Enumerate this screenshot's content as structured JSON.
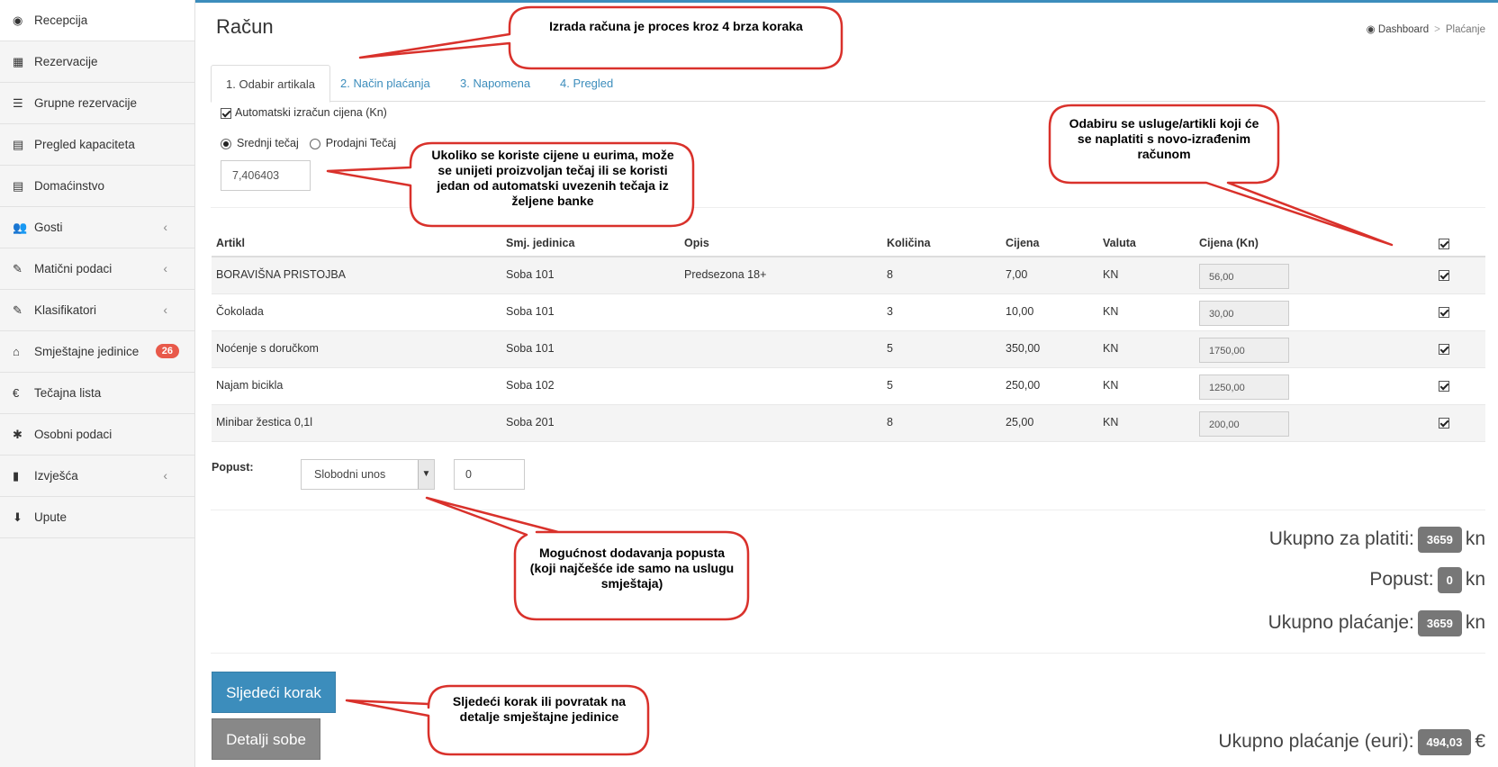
{
  "sidebar": {
    "items": [
      {
        "label": "Recepcija",
        "icon": "dashboard-icon",
        "glyph": "◉"
      },
      {
        "label": "Rezervacije",
        "icon": "grid-icon",
        "glyph": "▦"
      },
      {
        "label": "Grupne rezervacije",
        "icon": "list-icon",
        "glyph": "☰"
      },
      {
        "label": "Pregled kapaciteta",
        "icon": "calendar-icon",
        "glyph": "▤"
      },
      {
        "label": "Domaćinstvo",
        "icon": "list-alt-icon",
        "glyph": "▤"
      },
      {
        "label": "Gosti",
        "icon": "users-icon",
        "glyph": "👥"
      },
      {
        "label": "Matični podaci",
        "icon": "edit-icon",
        "glyph": "✎"
      },
      {
        "label": "Klasifikatori",
        "icon": "edit-icon",
        "glyph": "✎"
      },
      {
        "label": "Smještajne jedinice",
        "icon": "home-icon",
        "glyph": "⌂",
        "badge": "26"
      },
      {
        "label": "Tečajna lista",
        "icon": "euro-icon",
        "glyph": "€"
      },
      {
        "label": "Osobni podaci",
        "icon": "asterisk-icon",
        "glyph": "✱"
      },
      {
        "label": "Izvješća",
        "icon": "bar-chart-icon",
        "glyph": "▮"
      },
      {
        "label": "Upute",
        "icon": "download-icon",
        "glyph": "⬇"
      }
    ]
  },
  "header": {
    "title": "Račun",
    "breadcrumb": {
      "home": "Dashboard",
      "current": "Plaćanje"
    }
  },
  "tabs": [
    "1. Odabir artikala",
    "2. Način plaćanja",
    "3. Napomena",
    "4. Pregled"
  ],
  "options": {
    "auto_label": "Automatski izračun cijena (Kn)",
    "rate_middle": "Srednji tečaj",
    "rate_selling": "Prodajni Tečaj",
    "rate_value": "7,406403"
  },
  "table": {
    "headers": [
      "Artikl",
      "Smj. jedinica",
      "Opis",
      "Količina",
      "Cijena",
      "Valuta",
      "Cijena (Kn)"
    ],
    "rows": [
      [
        "BORAVIŠNA PRISTOJBA",
        "Soba 101",
        "Predsezona 18+",
        "8",
        "7,00",
        "KN",
        "56,00"
      ],
      [
        "Čokolada",
        "Soba 101",
        "",
        "3",
        "10,00",
        "KN",
        "30,00"
      ],
      [
        "Noćenje s doručkom",
        "Soba 101",
        "",
        "5",
        "350,00",
        "KN",
        "1750,00"
      ],
      [
        "Najam bicikla",
        "Soba 102",
        "",
        "5",
        "250,00",
        "KN",
        "1250,00"
      ],
      [
        "Minibar žestica 0,1l",
        "Soba 201",
        "",
        "8",
        "25,00",
        "KN",
        "200,00"
      ]
    ]
  },
  "discount": {
    "label": "Popust:",
    "select_value": "Slobodni unos",
    "input_value": "0"
  },
  "totals": {
    "total_label": "Ukupno za platiti:",
    "total_value": "3659",
    "discount_label": "Popust:",
    "discount_value": "0",
    "payment_label": "Ukupno plaćanje:",
    "payment_value": "3659",
    "currency": "kn",
    "euro_label": "Ukupno plaćanje (euri):",
    "euro_value": "494,03",
    "euro_sign": "€"
  },
  "buttons": {
    "next": "Sljedeći korak",
    "details": "Detalji sobe"
  },
  "callouts": {
    "steps": "Izrada računa je proces kroz 4 brza koraka",
    "rate": "Ukoliko se koriste cijene u eurima, može se unijeti proizvoljan tečaj ili se koristi jedan od automatski uvezenih tečaja iz željene banke",
    "items": "Odabiru se usluge/artikli koji će se naplatiti s novo-izrađenim računom",
    "discount": "Mogućnost dodavanja popusta (koji najčešće ide samo na uslugu smještaja)",
    "next": "Sljedeći korak ili povratak na detalje smještajne jedinice"
  }
}
